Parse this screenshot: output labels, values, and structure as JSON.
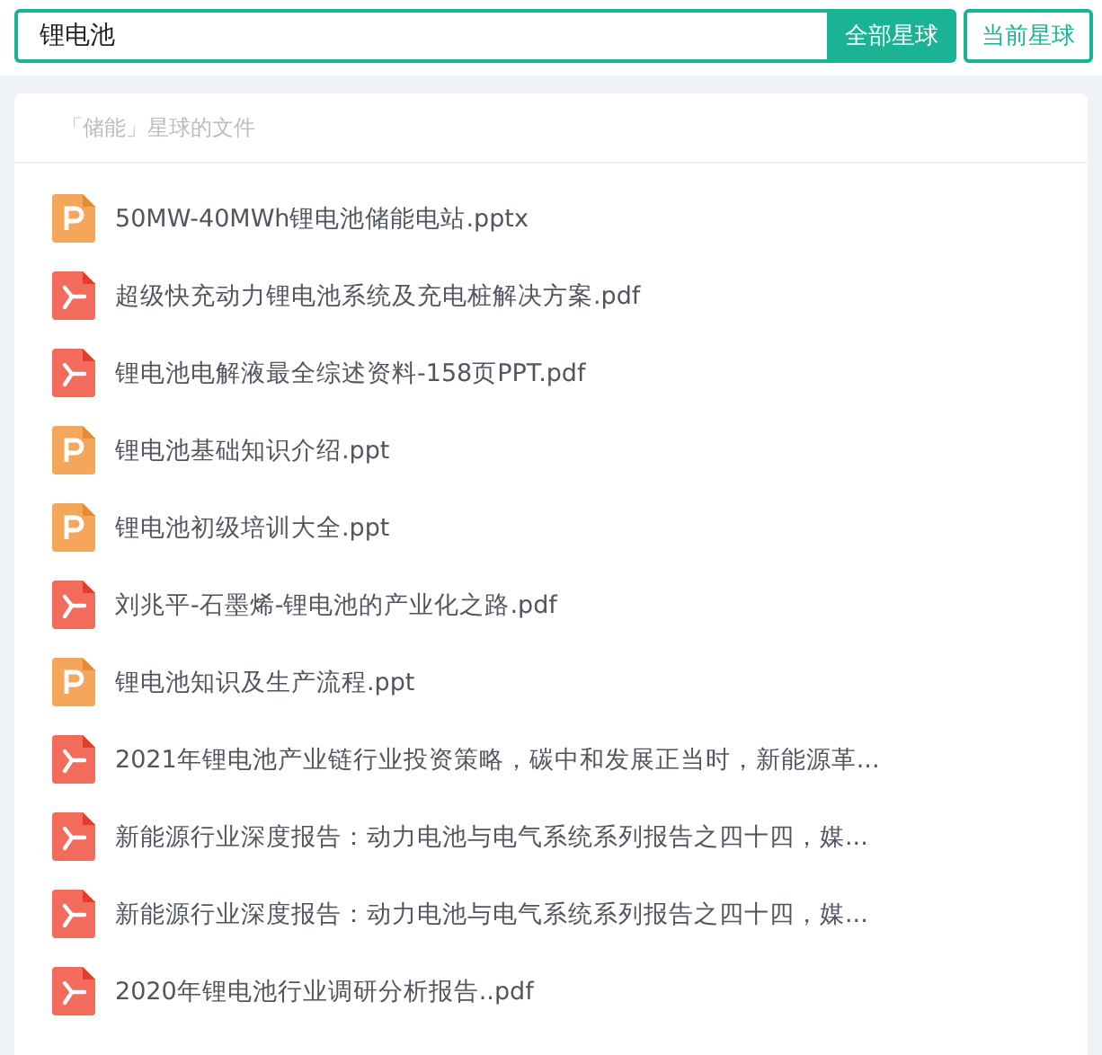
{
  "search": {
    "value": "锂电池"
  },
  "scopes": [
    {
      "label": "全部星球",
      "selected": true
    },
    {
      "label": "当前星球",
      "selected": false
    }
  ],
  "results": {
    "title": "「储能」星球的文件",
    "files": [
      {
        "kind": "ppt",
        "name": "50MW-40MWh锂电池储能电站.pptx"
      },
      {
        "kind": "pdf",
        "name": "超级快充动力锂电池系统及充电桩解决方案.pdf"
      },
      {
        "kind": "pdf",
        "name": "锂电池电解液最全综述资料-158页PPT.pdf"
      },
      {
        "kind": "ppt",
        "name": "锂电池基础知识介绍.ppt"
      },
      {
        "kind": "ppt",
        "name": "锂电池初级培训大全.ppt"
      },
      {
        "kind": "pdf",
        "name": "刘兆平-石墨烯-锂电池的产业化之路.pdf"
      },
      {
        "kind": "ppt",
        "name": "锂电池知识及生产流程.ppt"
      },
      {
        "kind": "pdf",
        "name": "2021年锂电池产业链行业投资策略，碳中和发展正当时，新能源革..."
      },
      {
        "kind": "pdf",
        "name": "新能源行业深度报告：动力电池与电气系统系列报告之四十四，媒..."
      },
      {
        "kind": "pdf",
        "name": "新能源行业深度报告：动力电池与电气系统系列报告之四十四，媒..."
      },
      {
        "kind": "pdf",
        "name": "2020年锂电池行业调研分析报告..pdf"
      }
    ]
  }
}
